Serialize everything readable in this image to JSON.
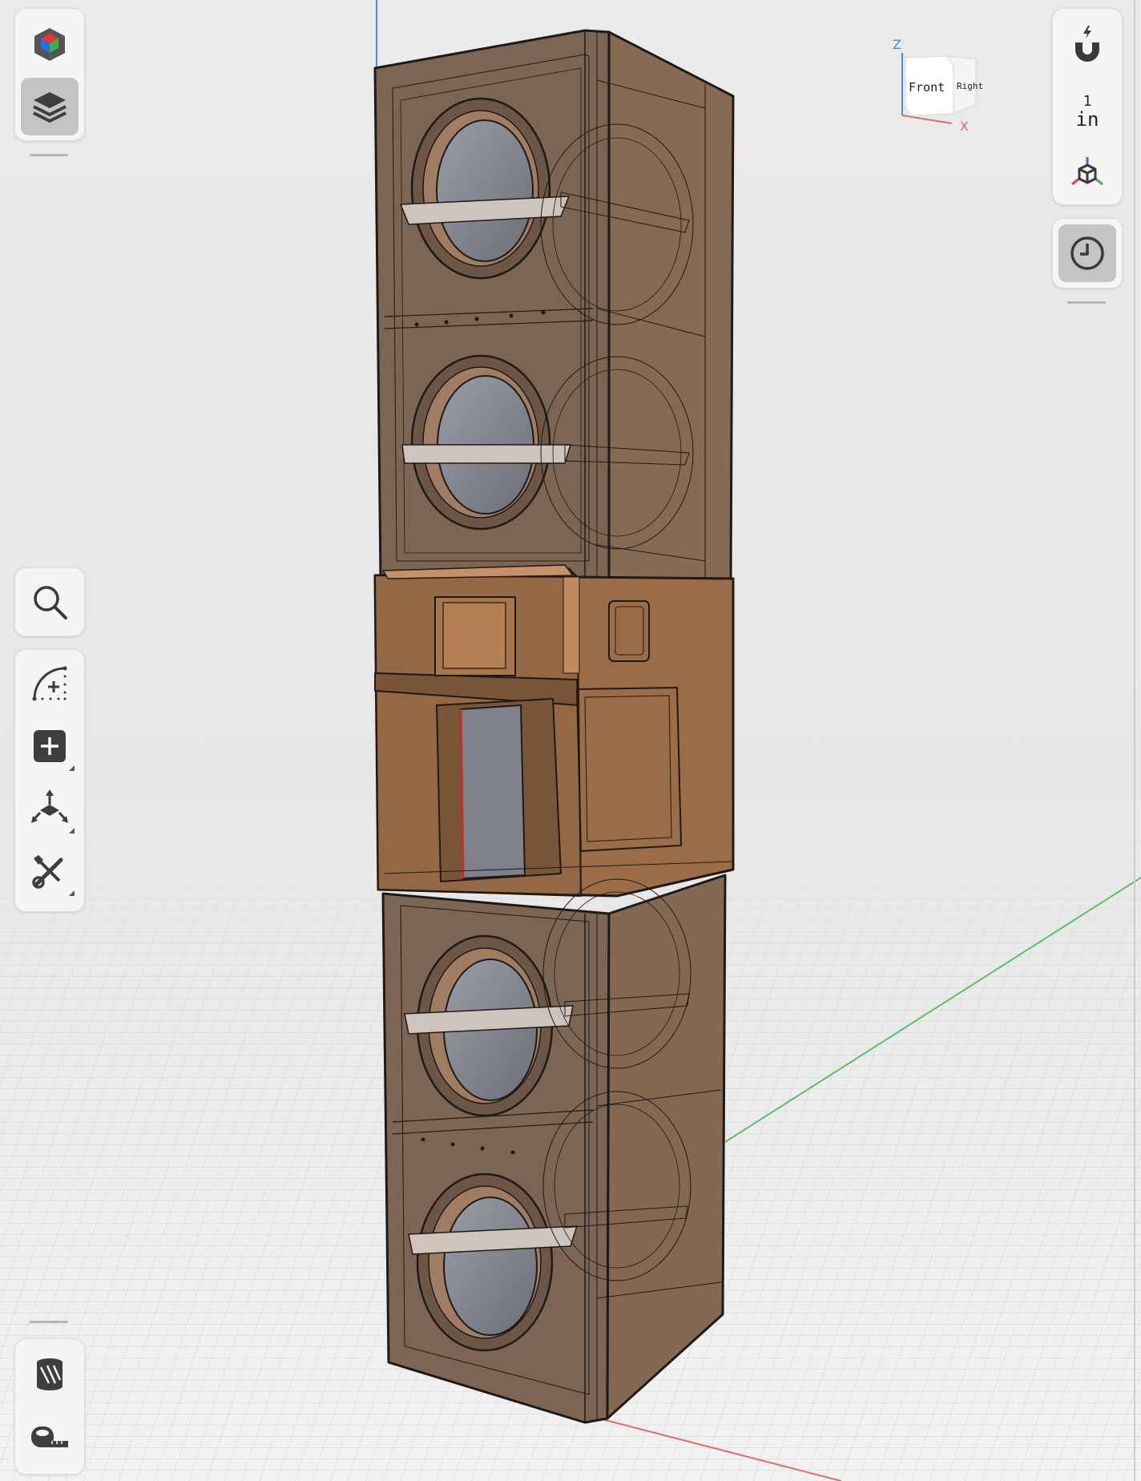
{
  "app": {
    "left_toolbar_top": [
      {
        "name": "appearance-cube-icon",
        "active": false
      },
      {
        "name": "layers-icon",
        "active": true
      }
    ],
    "left_toolbar_middle": [
      {
        "name": "search-icon"
      }
    ],
    "left_toolbar_tools": [
      {
        "name": "sketch-arc-icon",
        "has_submenu": false
      },
      {
        "name": "add-primitive-icon",
        "has_submenu": true
      },
      {
        "name": "transform-move-icon",
        "has_submenu": true
      },
      {
        "name": "modify-tools-icon",
        "has_submenu": true
      }
    ],
    "left_toolbar_bottom": [
      {
        "name": "section-view-icon"
      },
      {
        "name": "measure-tape-icon"
      }
    ],
    "right_toolbar": {
      "snap_icon": "magnet-snap-icon",
      "units_value": "1",
      "units_label": "in",
      "view_icon": "axes-cube-icon",
      "history_icon": "history-clock-icon"
    },
    "view_cube": {
      "front_label": "Front",
      "right_label": "Right",
      "axis_z": "Z",
      "axis_x": "X"
    },
    "colors": {
      "background": "#e9e9e9",
      "grid": "#d6d6d6",
      "axis_x": "#e36a6a",
      "axis_y": "#5cbf6a",
      "axis_z": "#4a8de0",
      "cabinet_main": "#7a6250",
      "cabinet_mid": "#9a6c46",
      "driver_cone": "#8a8d95"
    }
  }
}
